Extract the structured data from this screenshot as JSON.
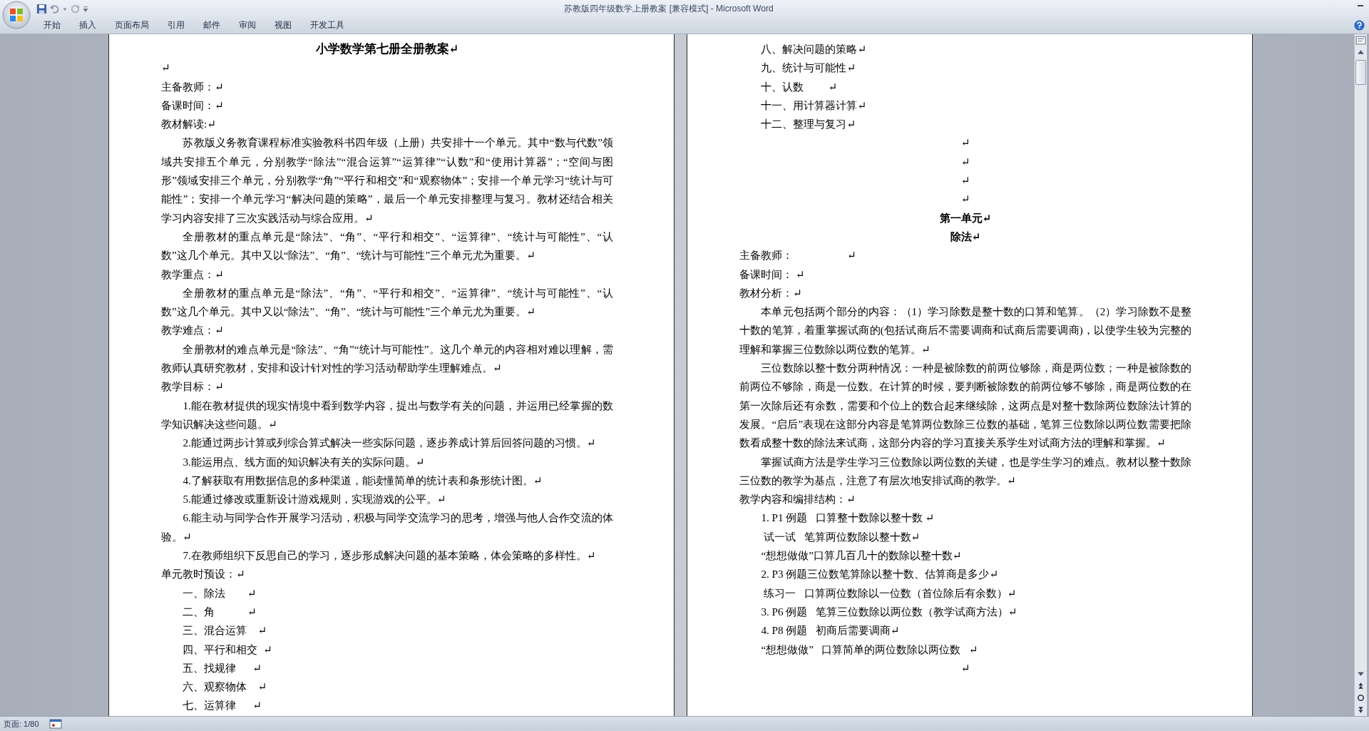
{
  "window": {
    "title": "苏教版四年级数学上册教案 [兼容模式] - Microsoft Word"
  },
  "ribbon_tabs": [
    {
      "label": "开始"
    },
    {
      "label": "插入"
    },
    {
      "label": "页面布局"
    },
    {
      "label": "引用"
    },
    {
      "label": "邮件"
    },
    {
      "label": "审阅"
    },
    {
      "label": "视图"
    },
    {
      "label": "开发工具"
    }
  ],
  "pages": [
    {
      "paragraphs": [
        {
          "kind": "title",
          "text": "小学数学第七册全册教案↵"
        },
        {
          "kind": "plain",
          "text": "↵"
        },
        {
          "kind": "plain",
          "text": "主备教师：↵"
        },
        {
          "kind": "plain",
          "text": "备课时间：↵"
        },
        {
          "kind": "plain",
          "text": "教材解读:↵"
        },
        {
          "kind": "indent",
          "text": "苏教版义务教育课程标准实验教科书四年级（上册）共安排十一个单元。其中“数与代数”领域共安排五个单元，分别教学“除法”“混合运算”“运算律”“认数”和“使用计算器”；“空间与图形”领域安排三个单元，分别教学“角”“平行和相交”和“观察物体”；安排一个单元学习“统计与可能性”；安排一个单元学习“解决问题的策略”，最后一个单元安排整理与复习。教材还结合相关学习内容安排了三次实践活动与综合应用。↵"
        },
        {
          "kind": "indent",
          "text": "全册教材的重点单元是“除法”、“角”、“平行和相交”、“运算律”、“统计与可能性”、“认数”这几个单元。其中又以“除法”、“角”、“统计与可能性”三个单元尤为重要。↵"
        },
        {
          "kind": "plain",
          "text": "教学重点：↵"
        },
        {
          "kind": "indent",
          "text": "全册教材的重点单元是“除法”、“角”、“平行和相交”、“运算律”、“统计与可能性”、“认数”这几个单元。其中又以“除法”、“角”、“统计与可能性”三个单元尤为重要。↵"
        },
        {
          "kind": "plain",
          "text": "教学难点：↵"
        },
        {
          "kind": "indent",
          "text": "全册教材的难点单元是“除法”、“角”“统计与可能性”。这几个单元的内容相对难以理解，需教师认真研究教材，安排和设计针对性的学习活动帮助学生理解难点。↵"
        },
        {
          "kind": "plain",
          "text": "教学目标：↵"
        },
        {
          "kind": "indent",
          "text": "1.能在教材提供的现实情境中看到数学内容，提出与数学有关的问题，并运用已经掌握的数学知识解决这些问题。↵"
        },
        {
          "kind": "indent",
          "text": "2.能通过两步计算或列综合算式解决一些实际问题，逐步养成计算后回答问题的习惯。↵"
        },
        {
          "kind": "indent",
          "text": "3.能运用点、线方面的知识解决有关的实际问题。↵"
        },
        {
          "kind": "indent",
          "text": "4.了解获取有用数据信息的多种渠道，能读懂简单的统计表和条形统计图。↵"
        },
        {
          "kind": "indent",
          "text": "5.能通过修改或重新设计游戏规则，实现游戏的公平。↵"
        },
        {
          "kind": "indent",
          "text": "6.能主动与同学合作开展学习活动，积极与同学交流学习的思考，增强与他人合作交流的体验。↵"
        },
        {
          "kind": "indent",
          "text": "7.在教师组织下反思自己的学习，逐步形成解决问题的基本策略，体会策略的多样性。↵"
        },
        {
          "kind": "plain",
          "text": "单元教时预设：↵"
        },
        {
          "kind": "list",
          "text": "一、除法        ↵"
        },
        {
          "kind": "list",
          "text": "二、角            ↵"
        },
        {
          "kind": "list",
          "text": "三、混合运算    ↵"
        },
        {
          "kind": "list",
          "text": "四、平行和相交  ↵"
        },
        {
          "kind": "list",
          "text": "五、找规律      ↵"
        },
        {
          "kind": "list",
          "text": "六、观察物体    ↵"
        },
        {
          "kind": "list",
          "text": "七、运算律      ↵"
        }
      ]
    },
    {
      "paragraphs": [
        {
          "kind": "list",
          "text": "八、解决问题的策略↵"
        },
        {
          "kind": "list",
          "text": "九、统计与可能性↵"
        },
        {
          "kind": "list",
          "text": "十、认数         ↵"
        },
        {
          "kind": "list",
          "text": "十一、用计算器计算↵"
        },
        {
          "kind": "list",
          "text": "十二、整理与复习↵"
        },
        {
          "kind": "center",
          "text": "↵"
        },
        {
          "kind": "center",
          "text": "↵"
        },
        {
          "kind": "center",
          "text": "↵"
        },
        {
          "kind": "center",
          "text": "↵"
        },
        {
          "kind": "heading",
          "text": "第一单元↵"
        },
        {
          "kind": "heading",
          "text": "除法↵"
        },
        {
          "kind": "plain",
          "text": "主备教师：                    ↵"
        },
        {
          "kind": "plain",
          "text": "备课时间： ↵"
        },
        {
          "kind": "plain",
          "text": "教材分析：↵"
        },
        {
          "kind": "indent",
          "text": "本单元包括两个部分的内容：（1）学习除数是整十数的口算和笔算。（2）学习除数不是整十数的笔算，着重掌握试商的(包括试商后不需要调商和试商后需要调商)，以使学生较为完整的理解和掌握三位数除以两位数的笔算。↵"
        },
        {
          "kind": "indent",
          "text": "三位数除以整十数分两种情况：一种是被除数的前两位够除，商是两位数；一种是被除数的前两位不够除，商是一位数。在计算的时候，要判断被除数的前两位够不够除，商是两位数的在第一次除后还有余数，需要和个位上的数合起来继续除，这两点是对整十数除两位数除法计算的发展。“启后”表现在这部分内容是笔算两位数除三位数的基础，笔算三位数除以两位数需要把除数看成整十数的除法来试商，这部分内容的学习直接关系学生对试商方法的理解和掌握。↵"
        },
        {
          "kind": "indent",
          "text": "掌握试商方法是学生学习三位数除以两位数的关键，也是学生学习的难点。教材以整十数除三位数的教学为基点，注意了有层次地安排试商的教学。↵"
        },
        {
          "kind": "plain",
          "text": "教学内容和编排结构：↵"
        },
        {
          "kind": "list",
          "text": "1. P1 例题   口算整十数除以整十数 ↵"
        },
        {
          "kind": "list",
          "text": " 试一试   笔算两位数除以整十数↵"
        },
        {
          "kind": "list",
          "text": "“想想做做”口算几百几十的数除以整十数↵"
        },
        {
          "kind": "list",
          "text": "2. P3 例题三位数笔算除以整十数、估算商是多少↵"
        },
        {
          "kind": "list",
          "text": " 练习一   口算两位数除以一位数（首位除后有余数）↵"
        },
        {
          "kind": "list",
          "text": "3. P6 例题   笔算三位数除以两位数（教学试商方法）↵"
        },
        {
          "kind": "list",
          "text": "4. P8 例题   初商后需要调商↵"
        },
        {
          "kind": "list",
          "text": "“想想做做”   口算简单的两位数除以两位数   ↵"
        },
        {
          "kind": "center",
          "text": "↵"
        }
      ]
    }
  ],
  "status_bar": {
    "page": "页面: 1/80"
  }
}
